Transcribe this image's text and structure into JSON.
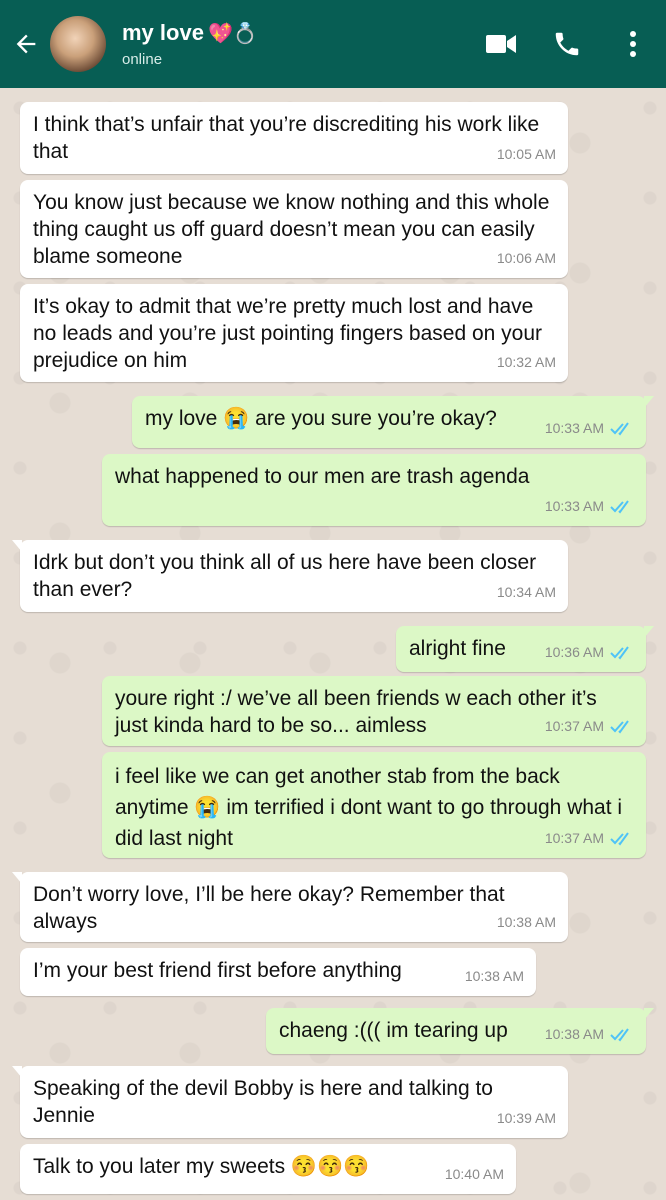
{
  "header": {
    "contact_name": "my love",
    "name_emoji": "💖💍",
    "status": "online",
    "icons": [
      "back-arrow-icon",
      "video-call-icon",
      "phone-icon",
      "more-options-icon"
    ]
  },
  "colors": {
    "header_bg": "#075e54",
    "incoming_bubble": "#ffffff",
    "outgoing_bubble": "#dcf8c6",
    "tick_blue": "#4fc3f7",
    "chat_bg": "#e6ddd4"
  },
  "messages": [
    {
      "dir": "in",
      "text": "I think that’s unfair that you’re discrediting his work like that",
      "time": "10:05 AM"
    },
    {
      "dir": "in",
      "text": "You know just because we know nothing and this whole thing caught us off guard doesn’t mean you can easily blame someone",
      "time": "10:06 AM"
    },
    {
      "dir": "in",
      "text": "It’s okay to admit that we’re pretty much lost and have no leads and you’re just pointing fingers based on your prejudice on him",
      "time": "10:32 AM"
    },
    {
      "dir": "out",
      "text": "my love 😭 are you sure you’re okay?",
      "time": "10:33 AM",
      "read": true
    },
    {
      "dir": "out",
      "text": "what happened to our men are trash agenda",
      "time": "10:33 AM",
      "read": true
    },
    {
      "dir": "in",
      "text": "Idrk but don’t you think all of us here have been closer than ever?",
      "time": "10:34 AM"
    },
    {
      "dir": "out",
      "text": "alright fine",
      "time": "10:36 AM",
      "read": true
    },
    {
      "dir": "out",
      "text": "youre right :/ we’ve all been friends w each other it’s just kinda hard to be so... aimless",
      "time": "10:37 AM",
      "read": true
    },
    {
      "dir": "out",
      "text": "i feel like we can get another stab from the back anytime 😭 im terrified i dont want to go through what i did last night",
      "time": "10:37 AM",
      "read": true
    },
    {
      "dir": "in",
      "text": "Don’t worry love, I’ll be here okay? Remember that always",
      "time": "10:38 AM"
    },
    {
      "dir": "in",
      "text": "I’m your best friend first before anything",
      "time": "10:38 AM"
    },
    {
      "dir": "out",
      "text": "chaeng :((( im tearing up",
      "time": "10:38 AM",
      "read": true
    },
    {
      "dir": "in",
      "text": "Speaking of the devil Bobby is here and talking to Jennie",
      "time": "10:39 AM"
    },
    {
      "dir": "in",
      "text": "Talk to you later my sweets 😚😚😚",
      "time": "10:40 AM"
    }
  ]
}
